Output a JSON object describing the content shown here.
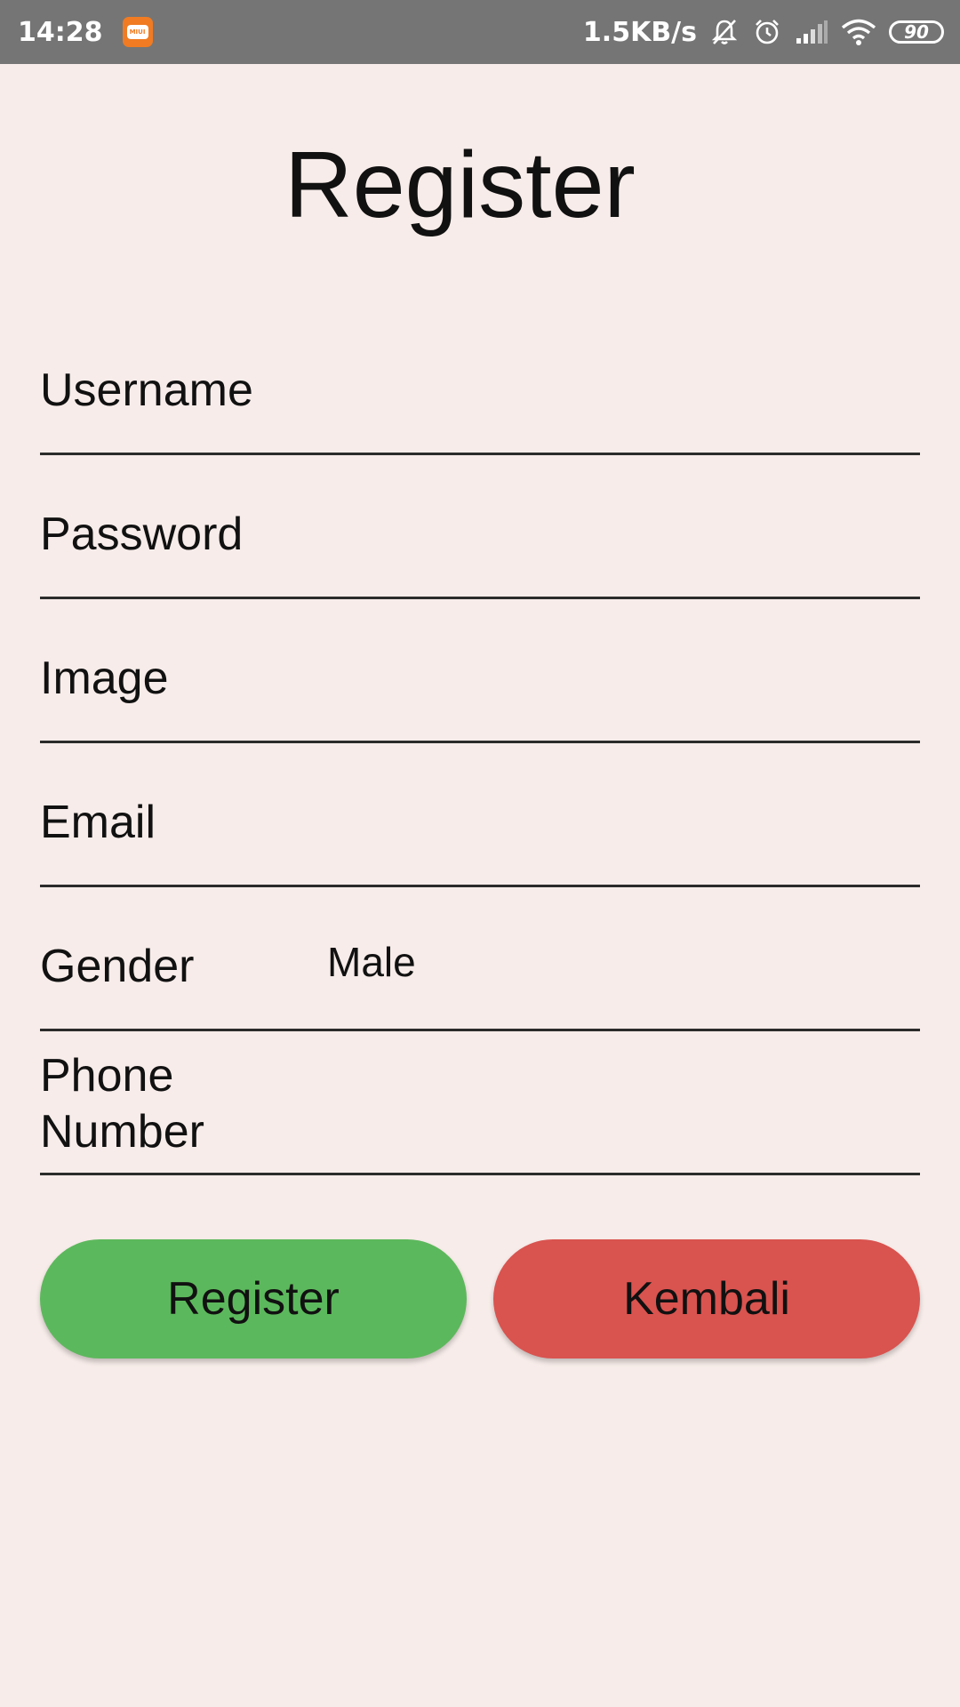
{
  "status_bar": {
    "time": "14:28",
    "app_badge": "MIUI",
    "net_speed": "1.5KB/s",
    "battery": "90",
    "icons": [
      "miui-message-icon",
      "bell-muted-icon",
      "alarm-icon",
      "signal-icon",
      "wifi-icon",
      "battery-icon"
    ]
  },
  "page": {
    "title": "Register"
  },
  "form": {
    "username_label": "Username",
    "password_label": "Password",
    "image_label": "Image",
    "email_label": "Email",
    "gender_label": "Gender",
    "gender_value": "Male",
    "phone_label": "Phone Number"
  },
  "buttons": {
    "register": "Register",
    "back": "Kembali"
  },
  "colors": {
    "background": "#f7ece9",
    "status_bar": "#757575",
    "register_button": "#5cb85c",
    "back_button": "#d9534f"
  }
}
